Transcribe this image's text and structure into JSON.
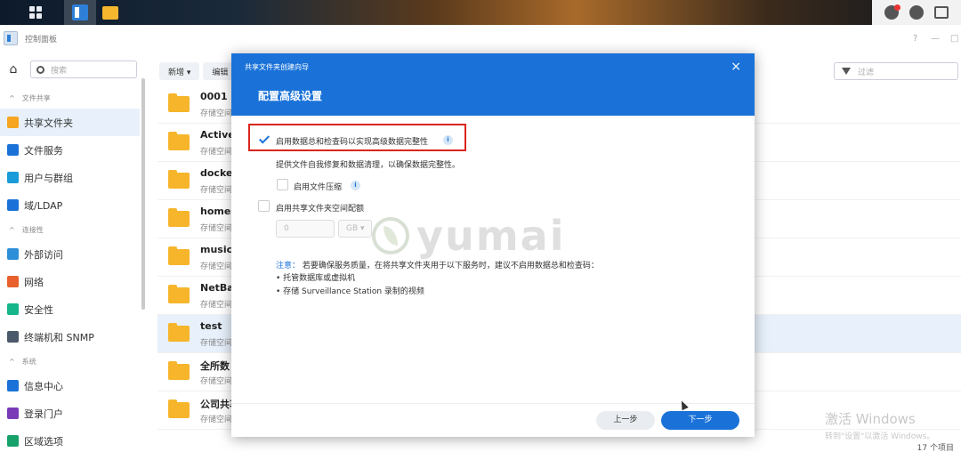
{
  "window": {
    "title": "控制面板",
    "controls": [
      "?",
      "—",
      "□"
    ]
  },
  "sidebar": {
    "search_placeholder": "搜索",
    "groups": [
      {
        "label": "文件共享",
        "items": [
          {
            "label": "共享文件夹",
            "icon": "shared-folder-icon",
            "color": "#f6a623"
          },
          {
            "label": "文件服务",
            "icon": "file-services-icon",
            "color": "#1a72d9"
          },
          {
            "label": "用户与群组",
            "icon": "users-groups-icon",
            "color": "#1a9bd9"
          },
          {
            "label": "域/LDAP",
            "icon": "domain-ldap-icon",
            "color": "#1a72d9"
          }
        ]
      },
      {
        "label": "连接性",
        "items": [
          {
            "label": "外部访问",
            "icon": "external-access-icon",
            "color": "#2d8fd8"
          },
          {
            "label": "网络",
            "icon": "network-icon",
            "color": "#e8602c"
          },
          {
            "label": "安全性",
            "icon": "security-icon",
            "color": "#16b58a"
          },
          {
            "label": "终端机和 SNMP",
            "icon": "terminal-snmp-icon",
            "color": "#4a5a6a"
          }
        ]
      },
      {
        "label": "系统",
        "items": [
          {
            "label": "信息中心",
            "icon": "info-center-icon",
            "color": "#1a72d9"
          },
          {
            "label": "登录门户",
            "icon": "login-portal-icon",
            "color": "#7a3ab8"
          },
          {
            "label": "区域选项",
            "icon": "regional-options-icon",
            "color": "#16a06a"
          }
        ]
      }
    ]
  },
  "toolbar": {
    "create_label": "新增 ▾",
    "edit_label": "编辑",
    "filter_placeholder": "过滤"
  },
  "folders": [
    {
      "name": "0001",
      "sub": "存储空间"
    },
    {
      "name": "Activel",
      "sub": "存储空间"
    },
    {
      "name": "docker",
      "sub": "存储空间"
    },
    {
      "name": "homes",
      "sub": "存储空间"
    },
    {
      "name": "music",
      "sub": "存储空间"
    },
    {
      "name": "NetBac",
      "sub": "存储空间"
    },
    {
      "name": "test",
      "sub": "存储空间"
    },
    {
      "name": "全所数",
      "sub": "存储空间"
    },
    {
      "name": "公司共享",
      "sub": "存储空间"
    }
  ],
  "item_count": "17 个项目",
  "activation": {
    "line1": "激活 Windows",
    "line2": "转到\"设置\"以激活 Windows。"
  },
  "watermark": "yumai",
  "dialog": {
    "wizard_title": "共享文件夹创建向导",
    "step_title": "配置高级设置",
    "close": "×",
    "checksum_label": "启用数据总和检查码以实现高级数据完整性",
    "checksum_desc": "提供文件自我修复和数据清理，以确保数据完整性。",
    "compression_label": "启用文件压缩",
    "quota_label": "启用共享文件夹空间配额",
    "quota_value": "0",
    "quota_unit": "GB ▾",
    "note_label": "注意：",
    "note_text": "若要确保服务质量，在将共享文件夹用于以下服务时，建议不启用数据总和检查码：",
    "note_items": [
      "• 托管数据库或虚拟机",
      "• 存储 Surveillance Station 录制的视频"
    ],
    "prev_label": "上一步",
    "next_label": "下一步",
    "info_glyph": "i"
  }
}
